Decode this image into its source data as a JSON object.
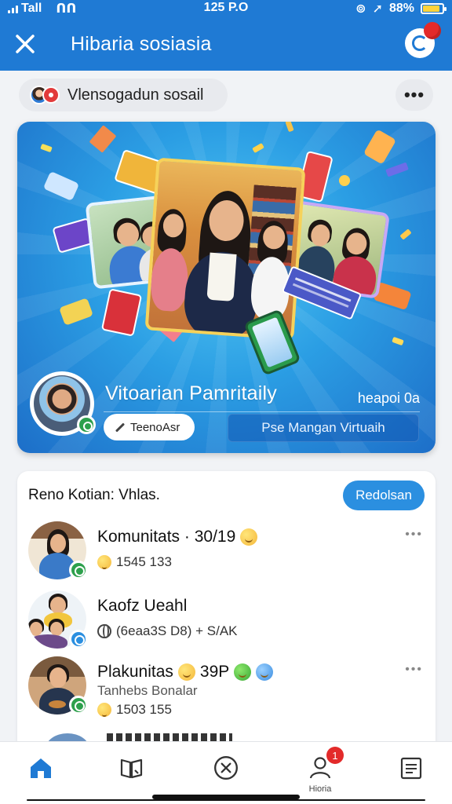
{
  "status_bar": {
    "left": "Tall",
    "carrier_short": "ᑎᑎ",
    "time": "125 P.O",
    "battery": "88%",
    "battery_level": 0.88
  },
  "header": {
    "title": "Hibaria sosiasia",
    "close_icon": "close-icon",
    "action_icon": "notification-pin-icon"
  },
  "group_pill": {
    "label": "Vlensogadun sosail"
  },
  "more_label": "•••",
  "hero": {
    "name": "Vitoarian Pamritaily",
    "meta": "heapoi 0a",
    "chip_label": "TeenoAsr",
    "cta_label": "Pse Mangan Virtuaih"
  },
  "feed": {
    "title": "Reno Kotian: Vhlas.",
    "action_label": "Redolsan",
    "items": [
      {
        "title": "Komunitats · 30/19",
        "line2": "1545 133",
        "line3": "",
        "badge_color": "#2da04c"
      },
      {
        "title": "Kaofz Ueahl",
        "line2": "(6eaa3S D8) + S/AK",
        "line3": "",
        "badge_color": "#2b8fe0"
      },
      {
        "title": "Plakunitas",
        "title_extra": "39P",
        "line2": "Tanhebs Bonalar",
        "line3": "1503 155",
        "badge_color": "#2da04c"
      }
    ],
    "more_label": "•••"
  },
  "nav": {
    "items": [
      {
        "icon": "home-icon",
        "label": ""
      },
      {
        "icon": "map-book-icon",
        "label": ""
      },
      {
        "icon": "cancel-circle-icon",
        "label": ""
      },
      {
        "icon": "profile-icon",
        "label": "Hioria",
        "badge": "1"
      },
      {
        "icon": "document-icon",
        "label": ""
      }
    ]
  },
  "colors": {
    "primary": "#1f7ad4",
    "accent": "#2b8fe0",
    "badge_red": "#e32a2a",
    "green": "#2da04c"
  }
}
